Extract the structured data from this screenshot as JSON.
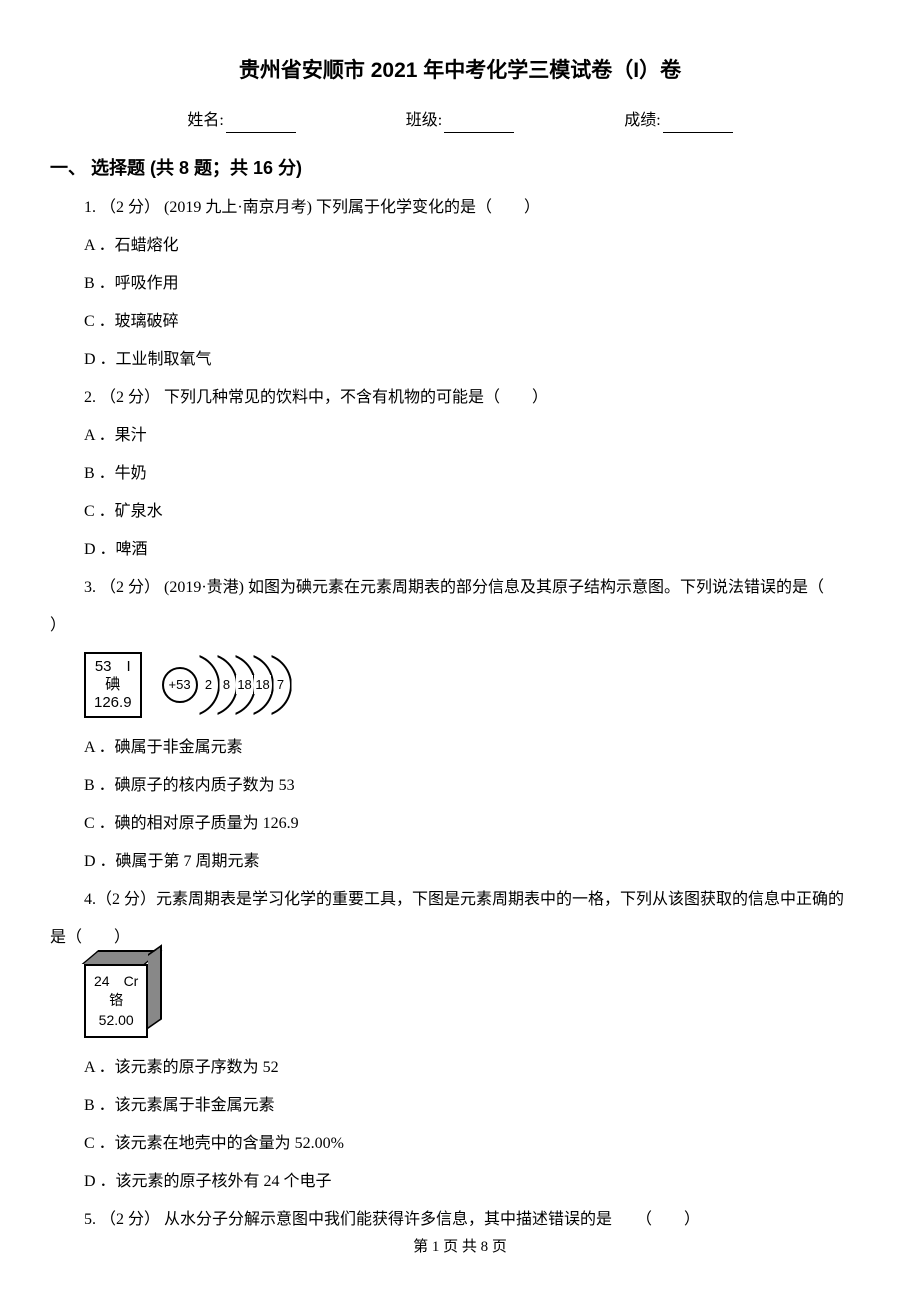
{
  "title": "贵州省安顺市 2021 年中考化学三模试卷（I）卷",
  "info": {
    "name_label": "姓名:",
    "class_label": "班级:",
    "score_label": "成绩:"
  },
  "section1": {
    "header": "一、 选择题 (共 8 题；共 16 分)",
    "q1": {
      "stem": "1. （2 分） (2019 九上·南京月考) 下列属于化学变化的是（　　）",
      "a": "A ．石蜡熔化",
      "b": "B ．呼吸作用",
      "c": "C ．玻璃破碎",
      "d": "D ．工业制取氧气"
    },
    "q2": {
      "stem": "2. （2 分） 下列几种常见的饮料中，不含有机物的可能是（　　）",
      "a": "A ．果汁",
      "b": "B ．牛奶",
      "c": "C ．矿泉水",
      "d": "D ．啤酒"
    },
    "q3": {
      "stem": "3. （2 分） (2019·贵港) 如图为碘元素在元素周期表的部分信息及其原子结构示意图。下列说法错误的是（",
      "stem_end": "）",
      "box_top": "53　I",
      "box_mid": "碘",
      "box_bottom": "126.9",
      "nucleus": "+53",
      "sh1": "2",
      "sh2": "8",
      "sh3": "18",
      "sh4": "18",
      "sh5": "7",
      "a": "A ．碘属于非金属元素",
      "b": "B ．碘原子的核内质子数为 53",
      "c": "C ．碘的相对原子质量为 126.9",
      "d": "D ．碘属于第 7 周期元素"
    },
    "q4": {
      "stem": "4.（2 分）元素周期表是学习化学的重要工具，下图是元素周期表中的一格，下列从该图获取的信息中正确的",
      "stem_end": "是（　　）",
      "box_top": "24　Cr",
      "box_mid": "铬",
      "box_bottom": "52.00",
      "a": "A ．该元素的原子序数为 52",
      "b": "B ．该元素属于非金属元素",
      "c": "C ．该元素在地壳中的含量为 52.00%",
      "d": "D ．该元素的原子核外有 24 个电子"
    },
    "q5": {
      "stem": "5. （2 分） 从水分子分解示意图中我们能获得许多信息，其中描述错误的是　　（　　）"
    }
  },
  "footer": "第 1 页 共 8 页"
}
